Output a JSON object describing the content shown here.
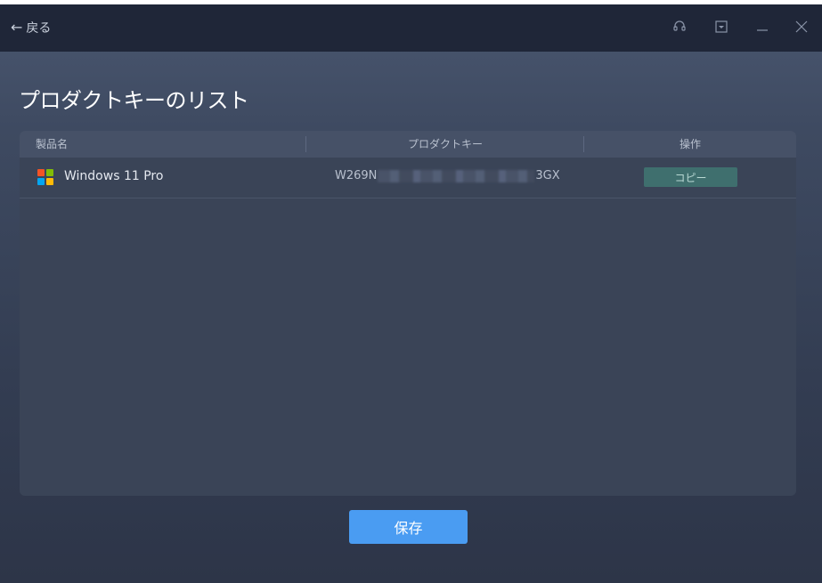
{
  "titlebar": {
    "back_label": "戻る",
    "icons": [
      "headset-icon",
      "minimize-to-tray-icon",
      "minimize-icon",
      "close-icon"
    ]
  },
  "page": {
    "title": "プロダクトキーのリスト"
  },
  "table": {
    "columns": [
      "製品名",
      "プロダクトキー",
      "操作"
    ],
    "rows": [
      {
        "product": "Windows 11 Pro",
        "key_start": "W269N",
        "key_end": "3GX",
        "action_label": "コピー"
      }
    ]
  },
  "footer": {
    "save_label": "保存"
  },
  "colors": {
    "accent": "#4a9cf2",
    "copy_button": "#3f6f6e",
    "titlebar": "#1f2638"
  }
}
